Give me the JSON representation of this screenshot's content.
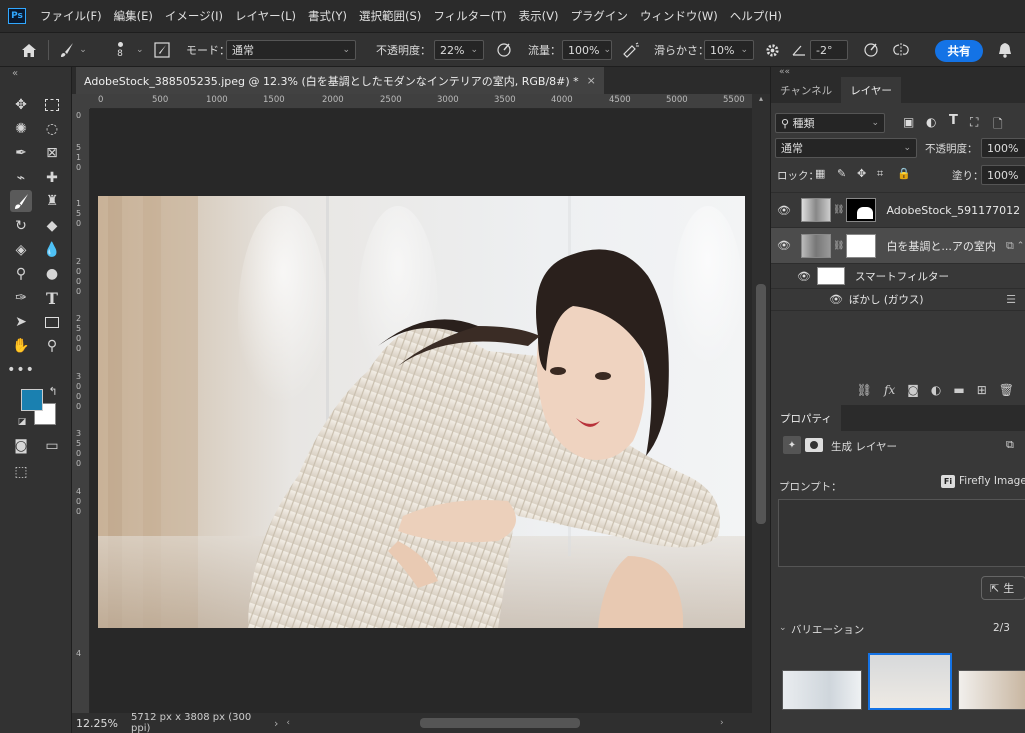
{
  "app": {
    "logo": "Ps"
  },
  "menu": [
    "ファイル(F)",
    "編集(E)",
    "イメージ(I)",
    "レイヤー(L)",
    "書式(Y)",
    "選択範囲(S)",
    "フィルター(T)",
    "表示(V)",
    "プラグイン",
    "ウィンドウ(W)",
    "ヘルプ(H)"
  ],
  "options": {
    "brush_size": "8",
    "mode_label": "モード：",
    "mode_value": "通常",
    "opacity_label": "不透明度：",
    "opacity_value": "22%",
    "flow_label": "流量：",
    "flow_value": "100%",
    "smoothing_label": "滑らかさ：",
    "smoothing_value": "10%",
    "angle_value": "-2°",
    "share_label": "共有"
  },
  "document": {
    "tab_title": "AdobeStock_388505235.jpeg @ 12.3% (白を基調としたモダンなインテリアの室内, RGB/8#) *",
    "close": "×"
  },
  "rulers": {
    "h": [
      "0",
      "500",
      "1000",
      "1500",
      "2000",
      "2500",
      "3000",
      "3500",
      "4000",
      "4500",
      "5000",
      "5500"
    ],
    "v": [
      "0",
      "5",
      "1",
      "0",
      "1",
      "5",
      "0",
      "2",
      "0",
      "0",
      "0",
      "2",
      "5",
      "0",
      "0",
      "3",
      "0",
      "0",
      "0",
      "3",
      "5",
      "0",
      "0",
      "4",
      "0",
      "0",
      "4"
    ]
  },
  "status": {
    "zoom": "12.25%",
    "info": "5712 px x 3808 px (300 ppi)",
    "arrow": "›"
  },
  "colors": {
    "foreground": "#1a80b0",
    "background": "#ffffff",
    "share": "#1473e6"
  },
  "tools": [
    "move-icon",
    "marquee-icon",
    "lasso-icon",
    "quick-select-icon",
    "crop-icon",
    "frame-icon",
    "eyedropper-icon",
    "spot-heal-icon",
    "brush-icon",
    "stamp-icon",
    "history-brush-icon",
    "eraser-icon",
    "gradient-icon",
    "blur-icon",
    "dodge-icon",
    "burn-icon",
    "pen-icon",
    "type-icon",
    "path-select-icon",
    "rectangle-icon",
    "hand-icon",
    "zoom-icon",
    "more-icon"
  ],
  "panel": {
    "tabs": [
      "チャンネル",
      "レイヤー"
    ],
    "filter_kind": "種類",
    "blend_mode": "通常",
    "opacity_label": "不透明度：",
    "opacity_value": "100%",
    "lock_label": "ロック：",
    "fill_label": "塗り：",
    "fill_value": "100%",
    "layers": [
      {
        "name": "AdobeStock_591177012"
      },
      {
        "name": "白を基調と...アの室内"
      }
    ],
    "smart_filter_label": "スマートフィルター",
    "blur_filter_label": "ぼかし (ガウス)"
  },
  "properties": {
    "tab": "プロパティ",
    "gen_layer_label": "生成 レイヤー",
    "prompt_label": "プロンプト：",
    "firefly_label": "Firefly Image",
    "firefly_badge": "Fi",
    "generate_label": "生",
    "variation_label": "バリエーション",
    "variation_count": "2/3"
  }
}
